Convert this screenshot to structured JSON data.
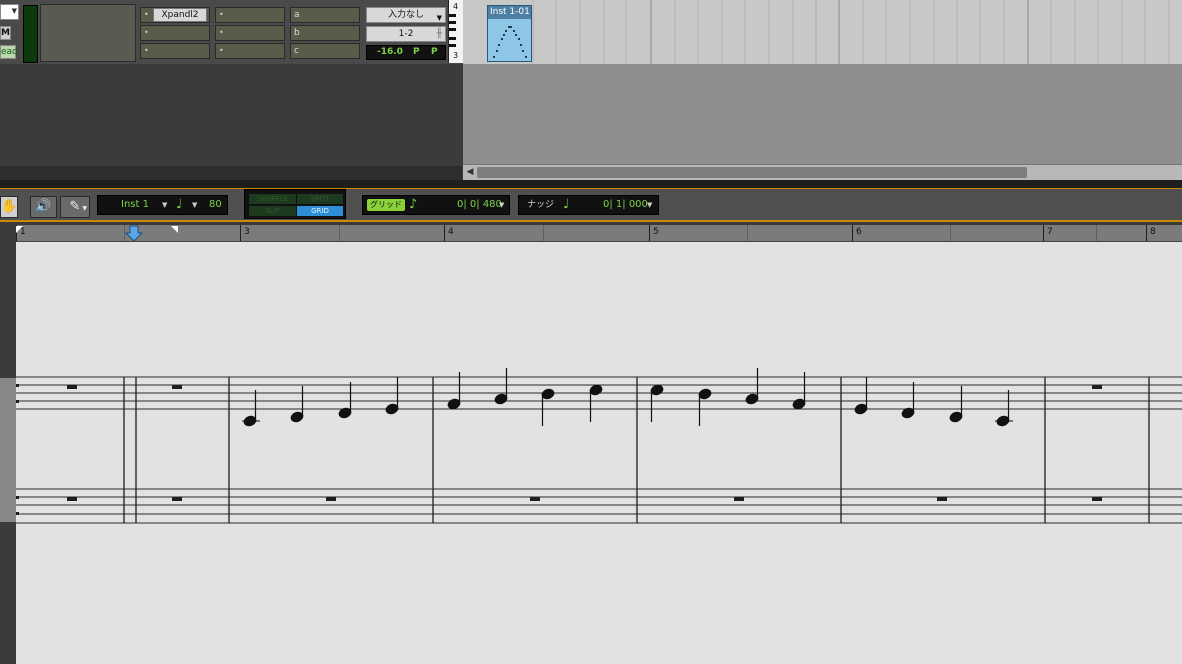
{
  "mixer": {
    "mute_label": "M",
    "read_label": "ead",
    "insert_a": "Xpandl2",
    "sends": [
      "a",
      "b",
      "c"
    ],
    "input": "入力なし",
    "output": "1-2",
    "volume": "-16.0",
    "pan_left": "P",
    "pan_right": "P"
  },
  "timeline": {
    "clip_name": "Inst 1-01",
    "keyboard_labels": [
      "4",
      "3"
    ]
  },
  "toolbar": {
    "track_name": "Inst 1",
    "tempo": "80",
    "modes": [
      "SHUFFLE",
      "SPOT",
      "SLIP",
      "GRID"
    ],
    "active_mode": "GRID",
    "grid_label": "グリッド",
    "grid_value": "0| 0| 480",
    "nudge_label": "ナッジ",
    "nudge_value": "0| 1| 000",
    "icons": [
      "hand-icon",
      "speaker-icon",
      "pencil-icon",
      "quarter-note-icon",
      "eighth-note-icon"
    ]
  },
  "ruler": {
    "bar_numbers": [
      "1",
      "3",
      "4",
      "5",
      "6",
      "7",
      "8"
    ]
  },
  "score": {
    "description_notes": "Treble staff: whole rests in bars 1-2, four quarter notes per bar 3-6 (ascending C-D-E-F, G-A-B-C, C-B-A-G, F-E-D-C), whole rests in bar 7. Bass staff: whole rests throughout."
  }
}
